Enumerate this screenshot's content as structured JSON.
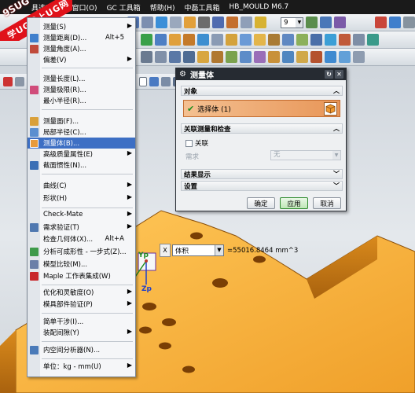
{
  "watermark": {
    "logo": "9SUG",
    "text": "学UG就上UG网"
  },
  "menubar": {
    "items": [
      "具选项(P)",
      "窗口(O)",
      "GC 工具箱",
      "帮助(H)",
      "中磊工具箱",
      "HB_MOULD M6.7"
    ]
  },
  "toolbar_spin": {
    "value": "9"
  },
  "menu": {
    "items": [
      {
        "label": "测量(S)",
        "shortcut": "",
        "submenu": true
      },
      {
        "label": "测量距离(D)...",
        "shortcut": "Alt+5",
        "submenu": false
      },
      {
        "label": "测量角度(A)...",
        "shortcut": "",
        "submenu": false
      },
      {
        "label": "偏差(V)",
        "shortcut": "",
        "submenu": true
      },
      {
        "label": "测量长度(L)...",
        "shortcut": "",
        "submenu": false
      },
      {
        "label": "测量极限(R)...",
        "shortcut": "",
        "submenu": false
      },
      {
        "label": "最小半径(R)...",
        "shortcut": "",
        "submenu": false
      },
      {
        "label": "测量面(F)...",
        "shortcut": "",
        "submenu": false
      },
      {
        "label": "局部半径(C)...",
        "shortcut": "",
        "submenu": false
      },
      {
        "label": "测量体(B)...",
        "shortcut": "",
        "submenu": false
      },
      {
        "label": "高级质量属性(E)",
        "shortcut": "",
        "submenu": true
      },
      {
        "label": "截面惯性(N)...",
        "shortcut": "",
        "submenu": false
      },
      {
        "label": "曲线(C)",
        "shortcut": "",
        "submenu": true
      },
      {
        "label": "形状(H)",
        "shortcut": "",
        "submenu": true
      },
      {
        "label": "Check-Mate",
        "shortcut": "",
        "submenu": true
      },
      {
        "label": "需求验证(T)",
        "shortcut": "",
        "submenu": true
      },
      {
        "label": "检查几何体(X)...",
        "shortcut": "Alt+A",
        "submenu": false
      },
      {
        "label": "分析可成形性 - 一步式(Z)...",
        "shortcut": "",
        "submenu": false
      },
      {
        "label": "模型比较(M)...",
        "shortcut": "",
        "submenu": false
      },
      {
        "label": "Maple 工作表集成(W)",
        "shortcut": "",
        "submenu": false
      },
      {
        "label": "优化和灵敏度(O)",
        "shortcut": "",
        "submenu": true
      },
      {
        "label": "模具部件验证(P)",
        "shortcut": "",
        "submenu": true
      },
      {
        "label": "简单干涉(I)...",
        "shortcut": "",
        "submenu": false
      },
      {
        "label": "装配间隙(Y)",
        "shortcut": "",
        "submenu": true
      },
      {
        "label": "内空间分析器(N)...",
        "shortcut": "",
        "submenu": false
      },
      {
        "label": "单位：kg - mm(U)",
        "shortcut": "",
        "submenu": true
      }
    ]
  },
  "dialog": {
    "title": "测量体",
    "section_object": "对象",
    "select_body": "选择体 (1)",
    "section_assoc": "关联测量和检查",
    "assoc_checkbox": "关联",
    "requirement_label": "需求",
    "requirement_value": "无",
    "section_results": "结果显示",
    "section_settings": "设置",
    "btn_ok": "确定",
    "btn_apply": "应用",
    "btn_cancel": "取消"
  },
  "readout": {
    "close": "X",
    "measure_type": "体积",
    "value": "=55016.8464 mm^3"
  },
  "axes": {
    "yp": "Yp",
    "zp": "Zp"
  },
  "colors": {
    "highlight": "#3d6fc4",
    "part": "#f2a42a",
    "dialog_title": "#262b32",
    "watermark": "#e0121a"
  }
}
